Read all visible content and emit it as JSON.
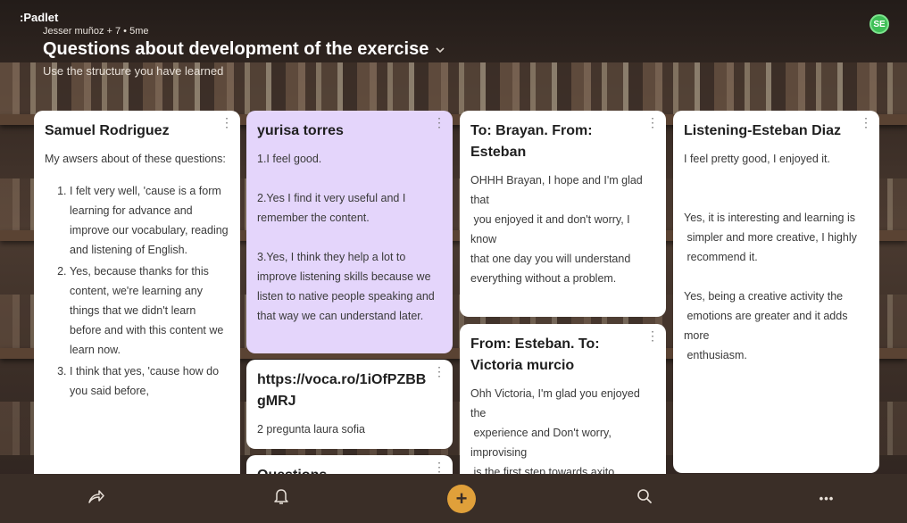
{
  "header": {
    "logo": ":Padlet",
    "meta": "Jesser muñoz + 7 • 5me",
    "title": "Questions about development of the exercise",
    "subtitle": "Use the structure you have learned",
    "avatar_initials": "SE"
  },
  "cards": [
    {
      "title": "Samuel Rodriguez",
      "intro": "My awsers about of these questions:",
      "list": [
        "I felt very well, 'cause is a form learning for advance and improve our vocabulary, reading and listening of English.",
        "Yes, because thanks for this content, we're learning any things that we didn't learn before and with this content we learn now.",
        "I think that yes, 'cause how do you said before,"
      ]
    },
    {
      "title": "yurisa torres",
      "body": "1.I feel good.\n\n2.Yes I find it very useful and I remember the content.\n\n3.Yes, I think they help a lot to improve listening skills because we listen to native people speaking and that way we can understand later."
    },
    {
      "title": "https://voca.ro/1iOfPZBBgMRJ",
      "body": "2 pregunta laura sofia"
    },
    {
      "title": "Questions"
    },
    {
      "title": "To: Brayan.     From: Esteban",
      "body": "OHHH Brayan, I hope and I'm glad that\n you enjoyed it and don't worry, I know\nthat one day you will understand everything without a problem."
    },
    {
      "title": "From: Esteban. To: Victoria murcio",
      "body": "Ohh Victoria, I'm glad you enjoyed the\n experience and Don't worry, improvising\n is the first step towards axito"
    },
    {
      "title": "Listening-Esteban Diaz",
      "body": "I feel pretty good, I enjoyed it.\n\n\nYes, it is interesting and learning is\n simpler and more creative, I highly\n recommend it.\n\nYes, being a creative activity the\n emotions are greater and it adds more\n enthusiasm."
    }
  ],
  "bottombar": {
    "share_icon": "share-arrow-icon",
    "bell_icon": "bell-icon",
    "plus_label": "+",
    "search_icon": "search-icon",
    "more_label": "•••"
  },
  "colors": {
    "card_purple": "#e4d5fb",
    "accent_plus": "#e0a03a",
    "avatar_green": "#3fbf57",
    "bar_bg": "#3a2e27"
  }
}
